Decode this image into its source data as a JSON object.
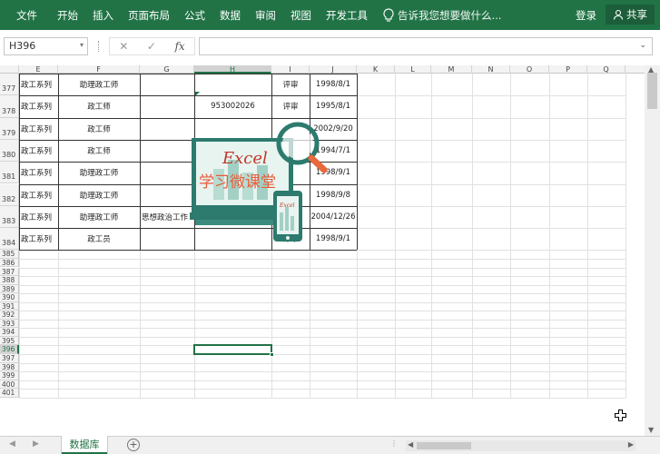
{
  "ribbon": {
    "tabs": [
      "文件",
      "开始",
      "插入",
      "页面布局",
      "公式",
      "数据",
      "审阅",
      "视图",
      "开发工具"
    ],
    "tell_me": "告诉我您想要做什么...",
    "login": "登录",
    "share": "共享",
    "colors": {
      "ribbon_bg": "#217346",
      "ribbon_text": "#ffffff"
    }
  },
  "formula_bar": {
    "name_box": "H396",
    "cancel_icon": "✕",
    "enter_icon": "✓",
    "fx_label": "fx",
    "formula_value": ""
  },
  "grid": {
    "columns": [
      "E",
      "F",
      "G",
      "H",
      "I",
      "J",
      "K",
      "L",
      "M",
      "N",
      "O",
      "P",
      "Q"
    ],
    "selected_column": "H",
    "rows": [
      {
        "num": "377",
        "E": "政工系列",
        "F": "助理政工师",
        "G": "",
        "H": "",
        "I": "评审",
        "J": "1998/8/1"
      },
      {
        "num": "378",
        "E": "政工系列",
        "F": "政工师",
        "G": "",
        "H": "953002026",
        "I": "评审",
        "J": "1995/8/1"
      },
      {
        "num": "379",
        "E": "政工系列",
        "F": "政工师",
        "G": "",
        "H": "",
        "I": "",
        "J": "2002/9/20"
      },
      {
        "num": "380",
        "E": "政工系列",
        "F": "政工师",
        "G": "",
        "H": "",
        "I": "",
        "J": "1994/7/1"
      },
      {
        "num": "381",
        "E": "政工系列",
        "F": "助理政工师",
        "G": "",
        "H": "",
        "I": "",
        "J": "1998/9/1"
      },
      {
        "num": "382",
        "E": "政工系列",
        "F": "助理政工师",
        "G": "",
        "H": "",
        "I": "",
        "J": "1998/9/8"
      },
      {
        "num": "383",
        "E": "政工系列",
        "F": "助理政工师",
        "G": "思想政治工作",
        "H": "",
        "I": "",
        "J": "2004/12/26"
      },
      {
        "num": "384",
        "E": "政工系列",
        "F": "政工员",
        "G": "",
        "H": "",
        "I": "评审",
        "J": "1998/9/1"
      }
    ],
    "empty_rows": [
      "385",
      "386",
      "387",
      "388",
      "389",
      "390",
      "391",
      "392",
      "393",
      "394",
      "395",
      "396",
      "397",
      "398",
      "399",
      "400",
      "401"
    ],
    "active_cell_row": "396"
  },
  "logo": {
    "word": "Excel",
    "subtitle": "学习微课堂",
    "small": "Excel"
  },
  "sheets": {
    "active": "数据库",
    "add_symbol": "+"
  }
}
